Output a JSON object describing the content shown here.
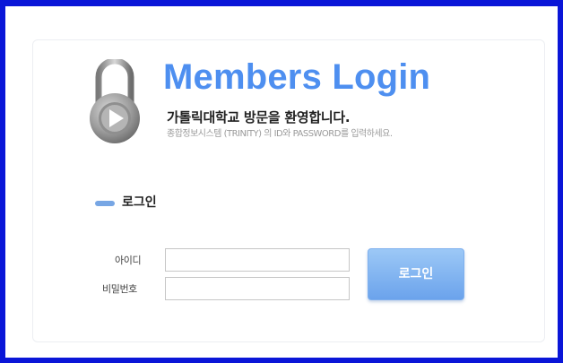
{
  "login": {
    "title": "Members Login",
    "welcome": "가톨릭대학교 방문을 환영합니다.",
    "subtext": "종합정보시스템 (TRINITY) 의 ID와 PASSWORD를 입력하세요.",
    "section_title": "로그인",
    "id_label": "아이디",
    "password_label": "비밀번호",
    "id_value": "",
    "password_value": "",
    "button_label": "로그인"
  },
  "icons": {
    "lock": "lock-play-icon",
    "section_marker": "section-marker-icon"
  },
  "colors": {
    "frame_border": "#0a16d8",
    "title": "#4e8ff0",
    "accent": "#77a6e4",
    "button": "#6ba3ec"
  }
}
